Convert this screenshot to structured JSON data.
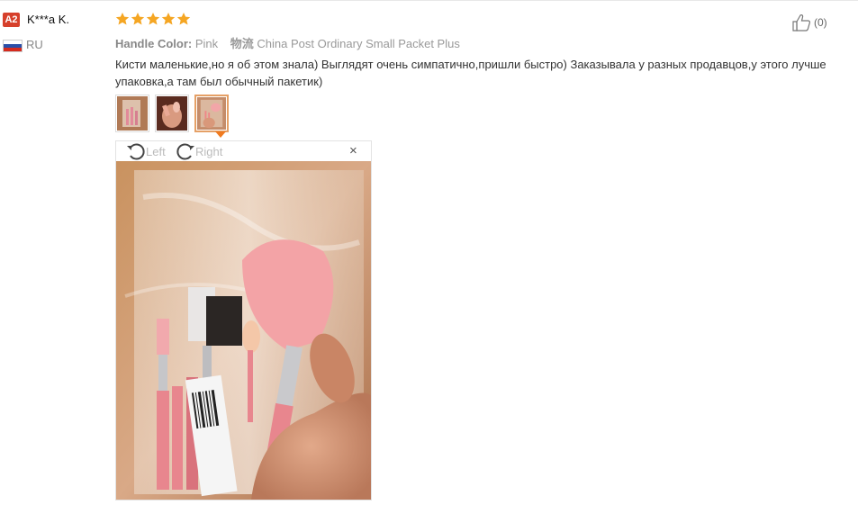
{
  "reviewer": {
    "badge": "A2",
    "name": "K***a K.",
    "country": "RU"
  },
  "rating": {
    "stars": 5,
    "max": 5,
    "color": "#f5a623"
  },
  "helpful": {
    "count_text": "(0)"
  },
  "attributes": {
    "handle_color_label": "Handle Color:",
    "handle_color_value": "Pink",
    "shipping_label": "物流",
    "shipping_value": "China Post Ordinary Small Packet Plus"
  },
  "review_text": "Кисти маленькие,но я об этом знала) Выглядят очень симпатично,пришли быстро) Заказывала у разных продавцов,у этого лучше упаковка,а там был обычный пакетик)",
  "thumbnails": [
    {
      "icon": "brush-package-photo-thumb",
      "active": false
    },
    {
      "icon": "hand-photo-thumb",
      "active": false
    },
    {
      "icon": "brush-bag-photo-thumb",
      "active": true
    }
  ],
  "viewer": {
    "rotate_left_label": "Left",
    "rotate_right_label": "Right",
    "close_symbol": "×"
  },
  "colors": {
    "badge_bg": "#d6402b",
    "accent_orange": "#f07a1f"
  }
}
